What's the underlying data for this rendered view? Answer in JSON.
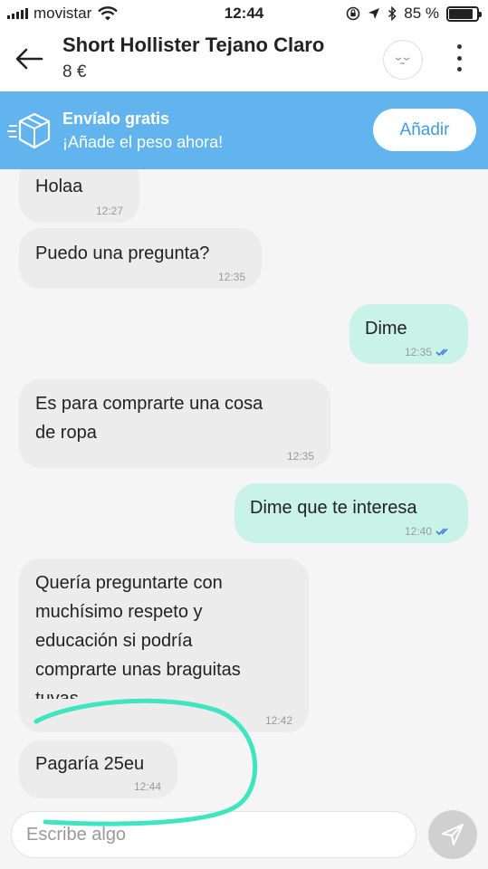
{
  "status_bar": {
    "carrier": "movistar",
    "time": "12:44",
    "battery_text": "85 %",
    "battery_level": 0.85
  },
  "header": {
    "back_icon": "arrow-left-icon",
    "title": "Short Hollister Tejano Claro",
    "price": "8 €",
    "avatar_icon": "sleeping-face-icon",
    "more_icon": "more-vertical-icon"
  },
  "banner": {
    "icon": "box-icon",
    "title": "Envíalo gratis",
    "subtitle": "¡Añade el peso ahora!",
    "button_label": "Añadir"
  },
  "messages": [
    {
      "direction": "in",
      "lines": [
        "Holaa"
      ],
      "time": "12:27"
    },
    {
      "direction": "in",
      "lines": [
        "Puedo una pregunta?"
      ],
      "time": "12:35"
    },
    {
      "direction": "out",
      "lines": [
        "Dime"
      ],
      "time": "12:35",
      "read": true
    },
    {
      "direction": "in",
      "lines": [
        "Es para comprarte una cosa",
        "de ropa"
      ],
      "time": "12:35"
    },
    {
      "direction": "out",
      "lines": [
        "Dime que te interesa"
      ],
      "time": "12:40",
      "read": true
    },
    {
      "direction": "in",
      "lines": [
        "Quería preguntarte con",
        "muchísimo respeto y",
        "educación si podría",
        "comprarte unas braguitas",
        "tuyas"
      ],
      "time": "12:42"
    },
    {
      "direction": "in",
      "lines": [
        "Pagaría 25eu"
      ],
      "time": "12:44"
    }
  ],
  "input": {
    "placeholder": "Escribe algo",
    "send_icon": "send-icon"
  },
  "colors": {
    "banner": "#61b4ee",
    "outgoing_bubble": "#c8f3e6",
    "incoming_bubble": "#ececec",
    "read_check": "#3f7fd8",
    "highlight_stroke": "#3ee6c0"
  }
}
